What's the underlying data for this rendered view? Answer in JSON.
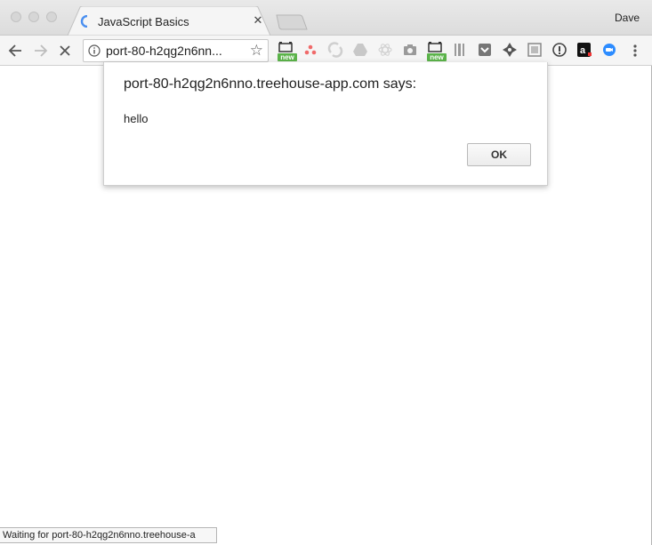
{
  "window": {
    "profile_name": "Dave"
  },
  "tab": {
    "title": "JavaScript Basics",
    "close_glyph": "✕"
  },
  "toolbar": {
    "url_text": "port-80-h2qg2n6nn...",
    "star_glyph": "☆",
    "extensions": [
      {
        "icon": "screen-capture-icon",
        "badge": "new"
      },
      {
        "icon": "asana-icon"
      },
      {
        "icon": "sync-icon"
      },
      {
        "icon": "google-drive-icon"
      },
      {
        "icon": "react-devtools-icon"
      },
      {
        "icon": "camera-icon"
      },
      {
        "icon": "screen-capture-icon",
        "badge": "new"
      },
      {
        "icon": "barcode-icon"
      },
      {
        "icon": "pocket-icon"
      },
      {
        "icon": "gear-diamond-icon"
      },
      {
        "icon": "frame-icon"
      },
      {
        "icon": "info-circle-icon"
      },
      {
        "icon": "amazon-icon"
      },
      {
        "icon": "zoom-icon"
      }
    ]
  },
  "dialog": {
    "title": "port-80-h2qg2n6nno.treehouse-app.com says:",
    "message": "hello",
    "ok_label": "OK"
  },
  "status": {
    "text": "Waiting for port-80-h2qg2n6nno.treehouse-a"
  },
  "colors": {
    "spinner": "#4a8ff0",
    "extension_badge": "#5bb34a"
  }
}
